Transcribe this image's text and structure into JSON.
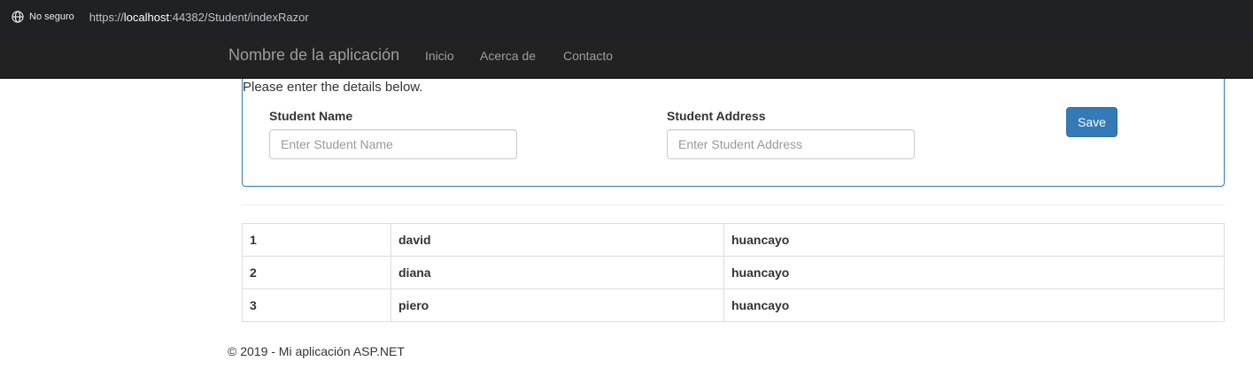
{
  "browser": {
    "security_label": "No seguro",
    "url_prefix": "https://",
    "url_host": "localhost",
    "url_rest": ":44382/Student/indexRazor",
    "security_icon": "globe-icon"
  },
  "navbar": {
    "brand": "Nombre de la aplicación",
    "links": [
      "Inicio",
      "Acerca de",
      "Contacto"
    ]
  },
  "form": {
    "instructions": "Please enter the details below.",
    "name_label": "Student Name",
    "name_placeholder": "Enter Student Name",
    "name_value": "",
    "address_label": "Student Address",
    "address_placeholder": "Enter Student Address",
    "address_value": "",
    "save_label": "Save"
  },
  "students": [
    {
      "id": "1",
      "name": "david",
      "address": "huancayo"
    },
    {
      "id": "2",
      "name": "diana",
      "address": "huancayo"
    },
    {
      "id": "3",
      "name": "piero",
      "address": "huancayo"
    }
  ],
  "footer": "© 2019 - Mi aplicación ASP.NET",
  "colors": {
    "primary": "#337ab7",
    "navbar": "#222222",
    "browser_bar": "#202124"
  }
}
